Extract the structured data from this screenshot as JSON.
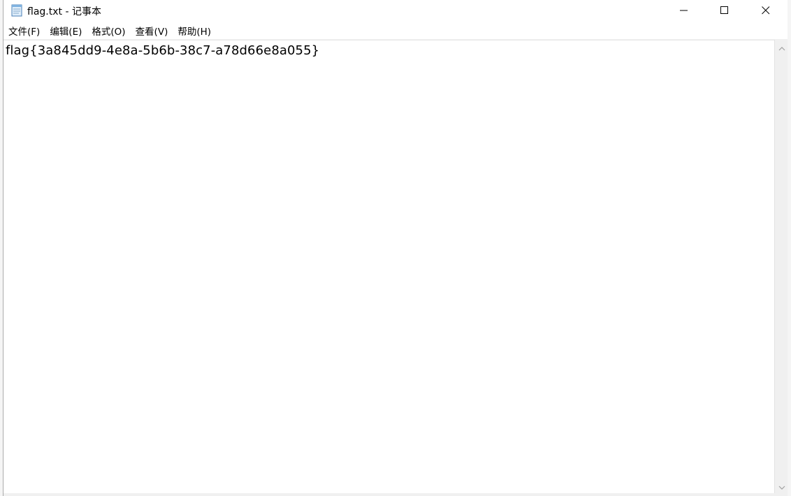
{
  "window": {
    "title": "flag.txt - 记事本"
  },
  "menu": {
    "items": [
      {
        "label": "文件(F)"
      },
      {
        "label": "编辑(E)"
      },
      {
        "label": "格式(O)"
      },
      {
        "label": "查看(V)"
      },
      {
        "label": "帮助(H)"
      }
    ]
  },
  "editor": {
    "content": "flag{3a845dd9-4e8a-5b6b-38c7-a78d66e8a055}"
  },
  "icons": {
    "app": "notepad-icon",
    "minimize": "minimize-icon",
    "maximize": "maximize-icon",
    "close": "close-icon",
    "scroll_up": "chevron-up-icon",
    "scroll_down": "chevron-down-icon"
  }
}
